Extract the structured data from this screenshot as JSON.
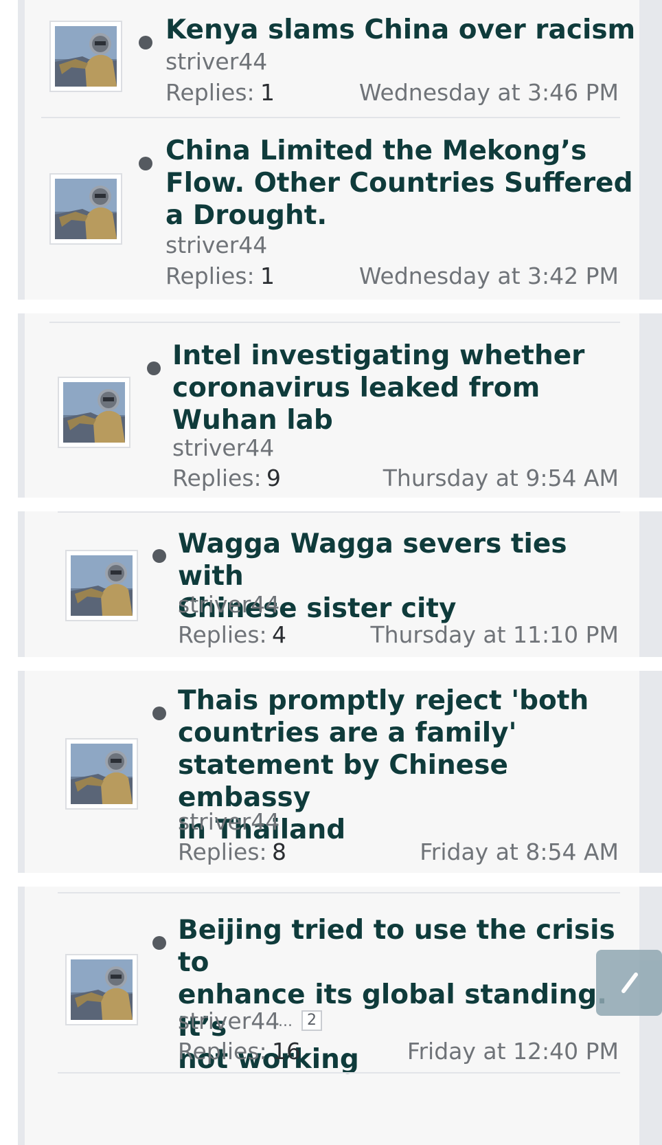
{
  "threads": [
    {
      "title_lines": [
        "Kenya slams China over racism"
      ],
      "author": "striver44",
      "replies_label": "Replies:",
      "replies": "1",
      "date": "Wednesday at 3:46 PM",
      "avatar_icon": "avatar-rider-icon"
    },
    {
      "title_lines": [
        "China Limited the Mekong’s",
        "Flow. Other Countries Suffered",
        "a Drought."
      ],
      "author": "striver44",
      "replies_label": "Replies:",
      "replies": "1",
      "date": "Wednesday at 3:42 PM",
      "avatar_icon": "avatar-rider-icon"
    },
    {
      "title_lines": [
        "Intel investigating whether",
        "coronavirus leaked from",
        "Wuhan lab"
      ],
      "author": "striver44",
      "replies_label": "Replies:",
      "replies": "9",
      "date": "Thursday at 9:54 AM",
      "avatar_icon": "avatar-rider-icon"
    },
    {
      "title_lines": [
        "Wagga Wagga severs ties with",
        "Chinese sister city"
      ],
      "author": "striver44",
      "replies_label": "Replies:",
      "replies": "4",
      "date": "Thursday at 11:10 PM",
      "avatar_icon": "avatar-rider-icon"
    },
    {
      "title_lines": [
        "Thais promptly reject 'both",
        "countries are a family'",
        "statement by Chinese embassy",
        "in Thailand"
      ],
      "author": "striver44",
      "replies_label": "Replies:",
      "replies": "8",
      "date": "Friday at 8:54 AM",
      "avatar_icon": "avatar-rider-icon"
    },
    {
      "title_lines": [
        "Beijing tried to use the crisis to",
        "enhance its global standing. It’s",
        "not working"
      ],
      "author": "striver44",
      "replies_label": "Replies:",
      "replies": "16",
      "date": "Friday at 12:40 PM",
      "avatar_icon": "avatar-rider-icon",
      "ellipsis": "...",
      "page_link": "2"
    }
  ],
  "ui": {
    "scroll_top_icon": "scroll-to-top-icon",
    "bullet_icon": "unread-bullet-icon"
  },
  "colors": {
    "title": "#0f3b3b",
    "meta": "#6f7378",
    "count": "#2a2d31",
    "card_bg": "#f7f7f7",
    "stripe": "#e6e8ec",
    "scroll_button": "#8fa7b2"
  }
}
